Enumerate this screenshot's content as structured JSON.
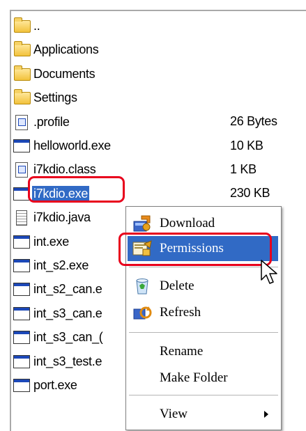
{
  "files": [
    {
      "name": "..",
      "size": "",
      "icon": "folder-icon"
    },
    {
      "name": "Applications",
      "size": "",
      "icon": "folder-icon"
    },
    {
      "name": "Documents",
      "size": "",
      "icon": "folder-icon"
    },
    {
      "name": "Settings",
      "size": "",
      "icon": "folder-icon"
    },
    {
      "name": ".profile",
      "size": "26 Bytes",
      "icon": "file-icon"
    },
    {
      "name": "helloworld.exe",
      "size": "10 KB",
      "icon": "exe-icon"
    },
    {
      "name": "i7kdio.class",
      "size": "1 KB",
      "icon": "file-icon"
    },
    {
      "name": "i7kdio.exe",
      "size": "230 KB",
      "icon": "exe-icon",
      "selected": true
    },
    {
      "name": "i7kdio.java",
      "size": "",
      "icon": "doc-icon"
    },
    {
      "name": "int.exe",
      "size": "",
      "icon": "exe-icon"
    },
    {
      "name": "int_s2.exe",
      "size": "",
      "icon": "exe-icon"
    },
    {
      "name": "int_s2_can.e",
      "size": "",
      "icon": "exe-icon"
    },
    {
      "name": "int_s3_can.e",
      "size": "",
      "icon": "exe-icon"
    },
    {
      "name": "int_s3_can_(",
      "size": "",
      "icon": "exe-icon"
    },
    {
      "name": "int_s3_test.e",
      "size": "",
      "icon": "exe-icon"
    },
    {
      "name": "port.exe",
      "size": "",
      "icon": "exe-icon"
    }
  ],
  "context_menu": {
    "download": "Download",
    "permissions": "Permissions",
    "delete": "Delete",
    "refresh": "Refresh",
    "rename": "Rename",
    "make_folder": "Make Folder",
    "view": "View"
  },
  "colors": {
    "selection": "#316ac5",
    "highlight_box": "#e8001c"
  }
}
